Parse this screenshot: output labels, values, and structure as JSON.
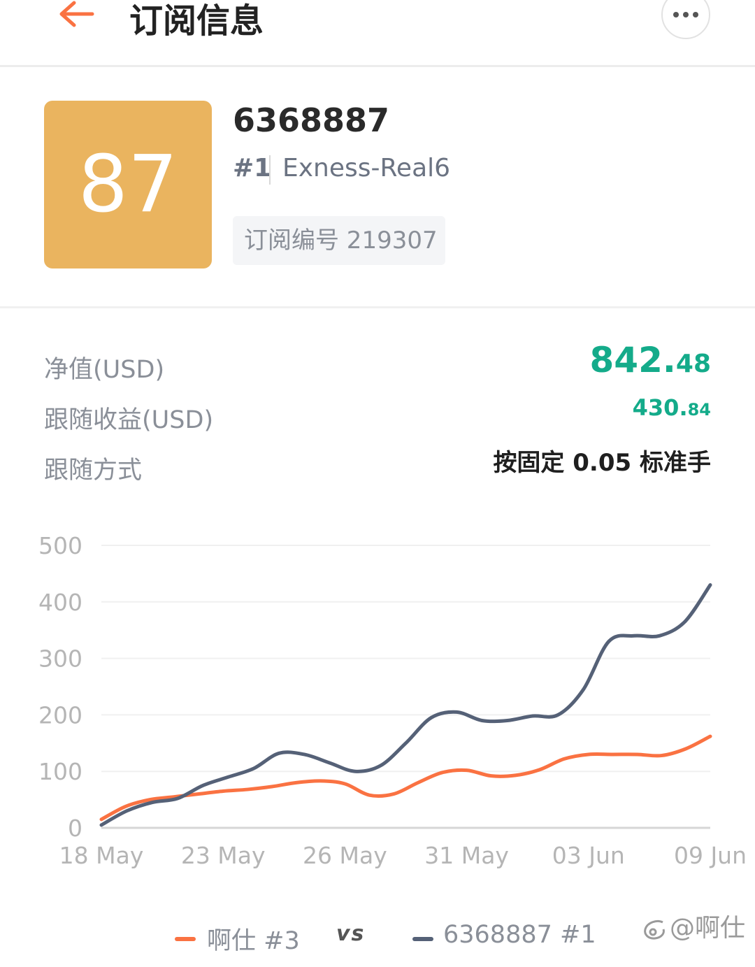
{
  "header": {
    "title": "订阅信息"
  },
  "account": {
    "score": "87",
    "id": "6368887",
    "rank": "#1",
    "server": "Exness-Real6",
    "subscription_label": "订阅编号 219307"
  },
  "stats": {
    "equity_label": "净值(USD)",
    "equity_int": "842.",
    "equity_dec": "48",
    "profit_label": "跟随收益(USD)",
    "profit_int": "430.",
    "profit_dec": "84",
    "mode_label": "跟随方式",
    "mode_value": "按固定 0.05 标准手"
  },
  "legend": {
    "vs": "vs",
    "watermark": "@啊仕"
  },
  "colors": {
    "accent_orange": "#fa7242",
    "series_dark": "#556177",
    "positive_green": "#14ab8a",
    "badge_gold": "#eab45f"
  },
  "chart_data": {
    "type": "line",
    "x_tick_labels": [
      "18 May",
      "23 May",
      "26 May",
      "31 May",
      "03 Jun",
      "09 Jun"
    ],
    "y_ticks": [
      0,
      100,
      200,
      300,
      400,
      500
    ],
    "ylim": [
      0,
      500
    ],
    "grid": true,
    "legend_position": "bottom",
    "x": [
      0,
      1,
      2,
      3,
      4,
      5,
      6,
      7,
      8,
      9,
      10,
      11,
      12,
      13,
      14,
      15,
      16,
      17,
      18,
      19,
      20,
      21,
      22,
      23,
      24,
      25
    ],
    "series": [
      {
        "name": "啊仕 #3",
        "color": "#fa7242",
        "values": [
          15,
          38,
          50,
          55,
          60,
          65,
          68,
          73,
          80,
          83,
          78,
          58,
          60,
          80,
          98,
          102,
          92,
          93,
          103,
          122,
          130,
          130,
          130,
          128,
          140,
          162
        ]
      },
      {
        "name": "6368887 #1",
        "color": "#556177",
        "values": [
          5,
          30,
          45,
          52,
          75,
          90,
          105,
          132,
          130,
          115,
          100,
          110,
          150,
          195,
          205,
          190,
          190,
          198,
          200,
          245,
          330,
          340,
          340,
          365,
          430
        ]
      }
    ]
  }
}
